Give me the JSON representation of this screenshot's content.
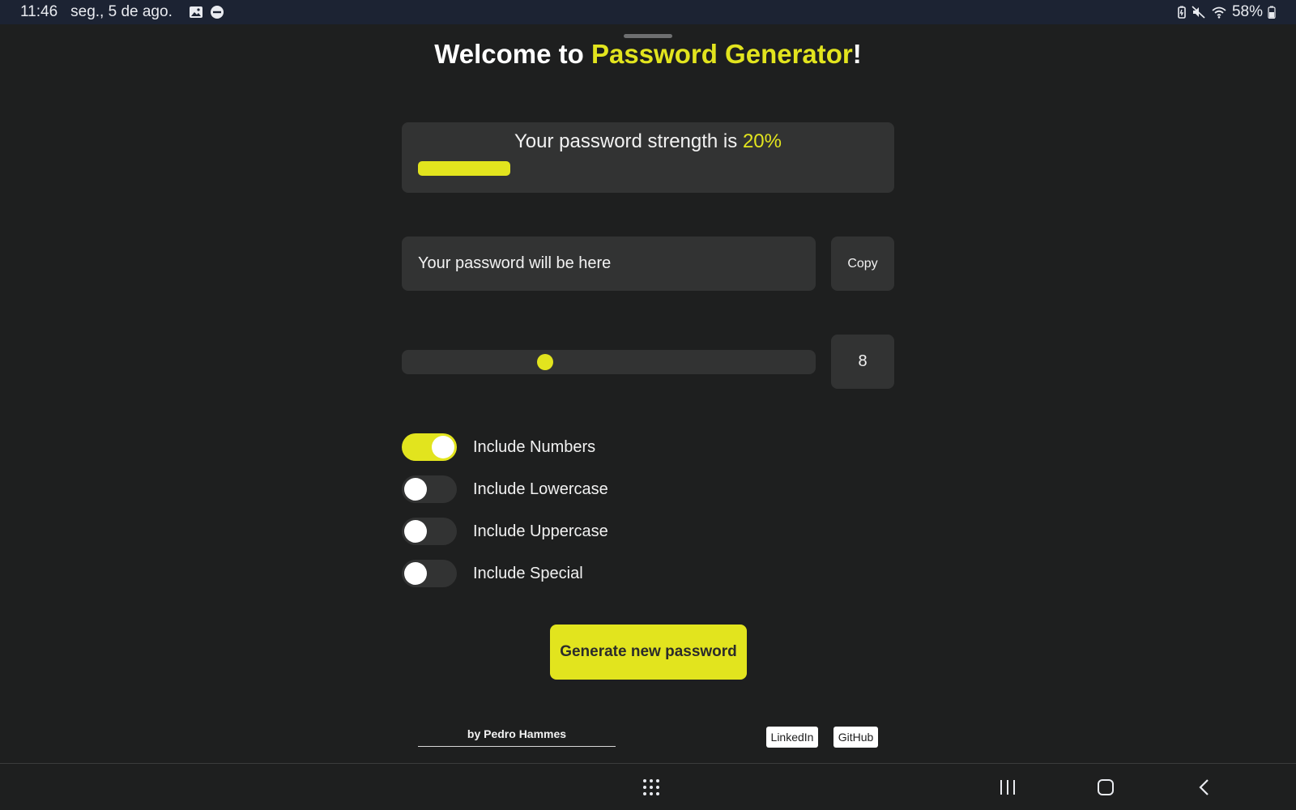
{
  "status_bar": {
    "time": "11:46",
    "date": "seg., 5 de ago.",
    "battery": "58%",
    "icons_left": [
      "gallery-icon",
      "do-not-disturb-icon"
    ],
    "icons_right": [
      "battery-saver-icon",
      "mute-icon",
      "wifi-icon",
      "battery-icon"
    ]
  },
  "header": {
    "title_prefix": "Welcome to ",
    "title_highlight": "Password Generator",
    "title_suffix": "!"
  },
  "strength": {
    "label": "Your password strength is ",
    "value_text": "20%",
    "value_fraction": 0.2
  },
  "password": {
    "placeholder": "Your password will be here",
    "value": "",
    "copy_label": "Copy"
  },
  "length": {
    "value": "8",
    "slider_fraction": 0.34
  },
  "options": [
    {
      "label": "Include Numbers",
      "on": true
    },
    {
      "label": "Include Lowercase",
      "on": false
    },
    {
      "label": "Include Uppercase",
      "on": false
    },
    {
      "label": "Include Special",
      "on": false
    }
  ],
  "generate_label": "Generate new password",
  "footer": {
    "author": "by Pedro Hammes",
    "links": [
      "LinkedIn",
      "GitHub"
    ]
  },
  "colors": {
    "accent": "#e2e41e",
    "background": "#1e1f1f",
    "card": "#323333",
    "status_bar": "#1c2333"
  }
}
